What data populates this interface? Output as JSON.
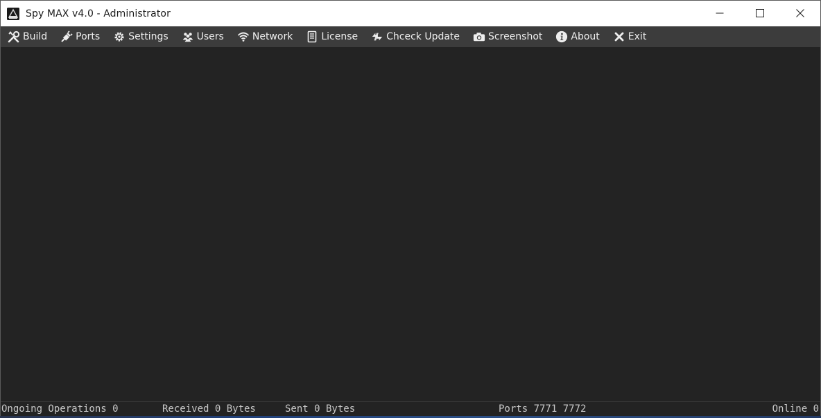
{
  "window": {
    "title": "Spy MAX v4.0 - Administrator",
    "icon": "spymax-app-icon",
    "controls": [
      "minimize-icon",
      "maximize-icon",
      "close-icon"
    ]
  },
  "menu": {
    "items": [
      {
        "label": "Build",
        "icon": "tools-icon"
      },
      {
        "label": "Ports",
        "icon": "plug-icon"
      },
      {
        "label": "Settings",
        "icon": "gear-icon"
      },
      {
        "label": "Users",
        "icon": "users-icon"
      },
      {
        "label": "Network",
        "icon": "wifi-icon"
      },
      {
        "label": "License",
        "icon": "document-icon"
      },
      {
        "label": "Chceck Update",
        "icon": "update-icon"
      },
      {
        "label": "Screenshot",
        "icon": "camera-icon"
      },
      {
        "label": "About",
        "icon": "info-icon"
      },
      {
        "label": "Exit",
        "icon": "x-icon"
      }
    ]
  },
  "status": {
    "ongoing": "Ongoing Operations 0",
    "received": "Received 0 Bytes",
    "sent": "Sent 0 Bytes",
    "ports": "Ports 7771 7772",
    "online": "Online 0"
  },
  "colors": {
    "titlebar": "#ffffff",
    "menubar": "#3c3c3c",
    "background": "#232323",
    "menu_text": "#efefef",
    "status_text": "#c8c8c8"
  }
}
